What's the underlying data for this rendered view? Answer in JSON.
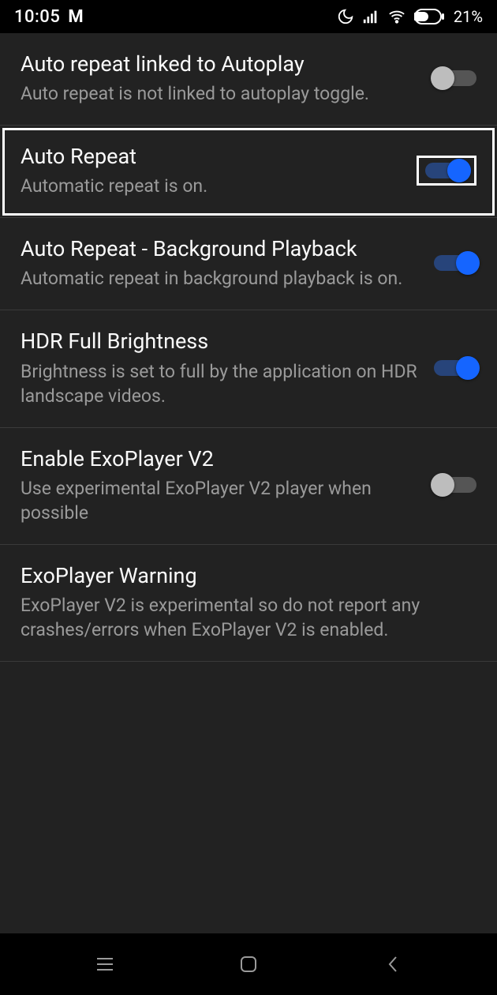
{
  "status": {
    "time": "10:05",
    "carrier_icon": "M",
    "battery_pct": "21%"
  },
  "rows": [
    {
      "title": "Auto repeat linked to Autoplay",
      "sub": "Auto repeat is not linked to autoplay toggle.",
      "toggle": "off",
      "highlight": false
    },
    {
      "title": "Auto Repeat",
      "sub": "Automatic repeat is on.",
      "toggle": "on",
      "highlight": true
    },
    {
      "title": "Auto Repeat - Background Playback",
      "sub": "Automatic repeat in background playback is on.",
      "toggle": "on",
      "highlight": false
    },
    {
      "title": "HDR Full Brightness",
      "sub": "Brightness is set to full by the application on HDR landscape videos.",
      "toggle": "on",
      "highlight": false
    },
    {
      "title": "Enable ExoPlayer V2",
      "sub": "Use experimental ExoPlayer V2 player when possible",
      "toggle": "off",
      "highlight": false
    },
    {
      "title": "ExoPlayer Warning",
      "sub": "ExoPlayer V2 is experimental so do not report any crashes/errors when ExoPlayer V2 is enabled.",
      "toggle": null,
      "highlight": false
    }
  ]
}
